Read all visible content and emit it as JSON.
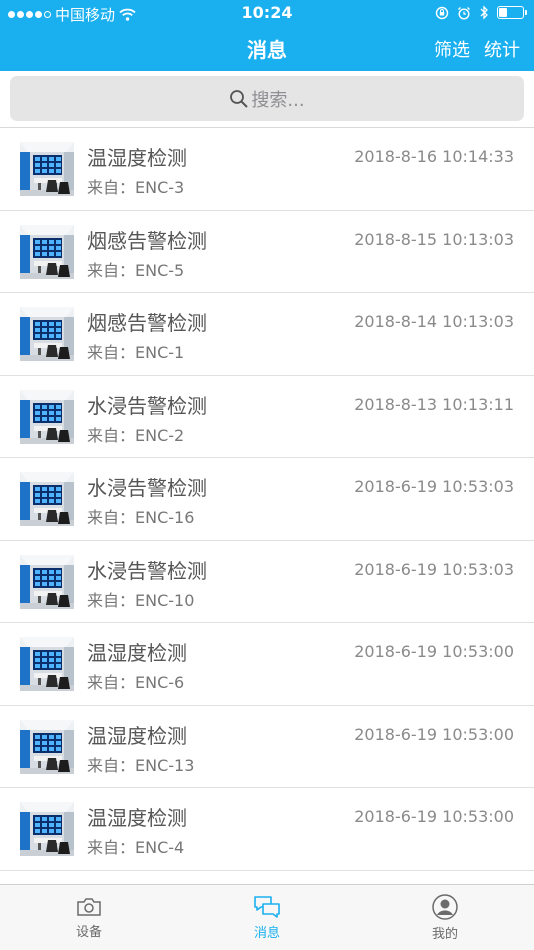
{
  "status_bar": {
    "carrier": "中国移动",
    "time": "10:24"
  },
  "nav": {
    "title": "消息",
    "filter_label": "筛选",
    "stats_label": "统计"
  },
  "search": {
    "placeholder": "搜索..."
  },
  "messages": [
    {
      "title": "温湿度检测",
      "source": "来自：ENC-3",
      "time": "2018-8-16 10:14:33"
    },
    {
      "title": "烟感告警检测",
      "source": "来自：ENC-5",
      "time": "2018-8-15 10:13:03"
    },
    {
      "title": "烟感告警检测",
      "source": "来自：ENC-1",
      "time": "2018-8-14 10:13:03"
    },
    {
      "title": "水浸告警检测",
      "source": "来自：ENC-2",
      "time": "2018-8-13 10:13:11"
    },
    {
      "title": "水浸告警检测",
      "source": "来自：ENC-16",
      "time": "2018-6-19 10:53:03"
    },
    {
      "title": "水浸告警检测",
      "source": "来自：ENC-10",
      "time": "2018-6-19 10:53:03"
    },
    {
      "title": "温湿度检测",
      "source": "来自：ENC-6",
      "time": "2018-6-19 10:53:00"
    },
    {
      "title": "温湿度检测",
      "source": "来自：ENC-13",
      "time": "2018-6-19 10:53:00"
    },
    {
      "title": "温湿度检测",
      "source": "来自：ENC-4",
      "time": "2018-6-19 10:53:00"
    }
  ],
  "tabs": [
    {
      "label": "设备",
      "icon": "camera-icon",
      "active": false
    },
    {
      "label": "消息",
      "icon": "chat-icon",
      "active": true
    },
    {
      "label": "我的",
      "icon": "profile-icon",
      "active": false
    }
  ],
  "colors": {
    "accent": "#1ab0f0"
  }
}
